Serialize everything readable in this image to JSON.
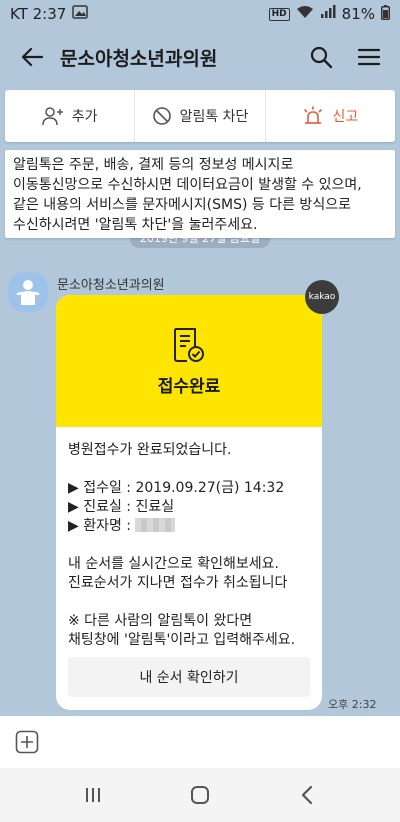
{
  "status": {
    "carrier_time": "KT 2:37",
    "hd": "HD",
    "battery": "81%"
  },
  "header": {
    "title": "문소아청소년과의원"
  },
  "actions": {
    "add": "추가",
    "block": "알림톡 차단",
    "report": "신고"
  },
  "notice": "알림톡은 주문, 배송, 결제 등의 정보성 메시지로 이동통신망으로 수신하시면 데이터요금이 발생할 수 있으며, 같은 내용의 서비스를 문자메시지(SMS) 등 다른 방식으로 수신하시려면 '알림톡 차단'을 눌러주세요.",
  "date_pill": "2019년 9월 27일 금요일",
  "message": {
    "sender": "문소아청소년과의원",
    "badge": "kakao",
    "banner_title": "접수완료",
    "lines": {
      "l1": "병원접수가 완료되었습니다.",
      "l2": "▶ 접수일 : 2019.09.27(금) 14:32",
      "l3": "▶ 진료실 : 진료실",
      "l4": "▶ 환자명 : ",
      "l5": "내 순서를 실시간으로 확인해보세요.",
      "l6": "진료순서가 지나면 접수가 취소됩니다",
      "l7": "※ 다른 사람의 알림톡이 왔다면",
      "l8": "채팅창에 '알림톡'이라고 입력해주세요."
    },
    "button_label": "내 순서 확인하기",
    "time": "오후 2:32"
  },
  "colors": {
    "background": "#b2c7da",
    "banner": "#fee500",
    "report": "#e35c3a"
  }
}
